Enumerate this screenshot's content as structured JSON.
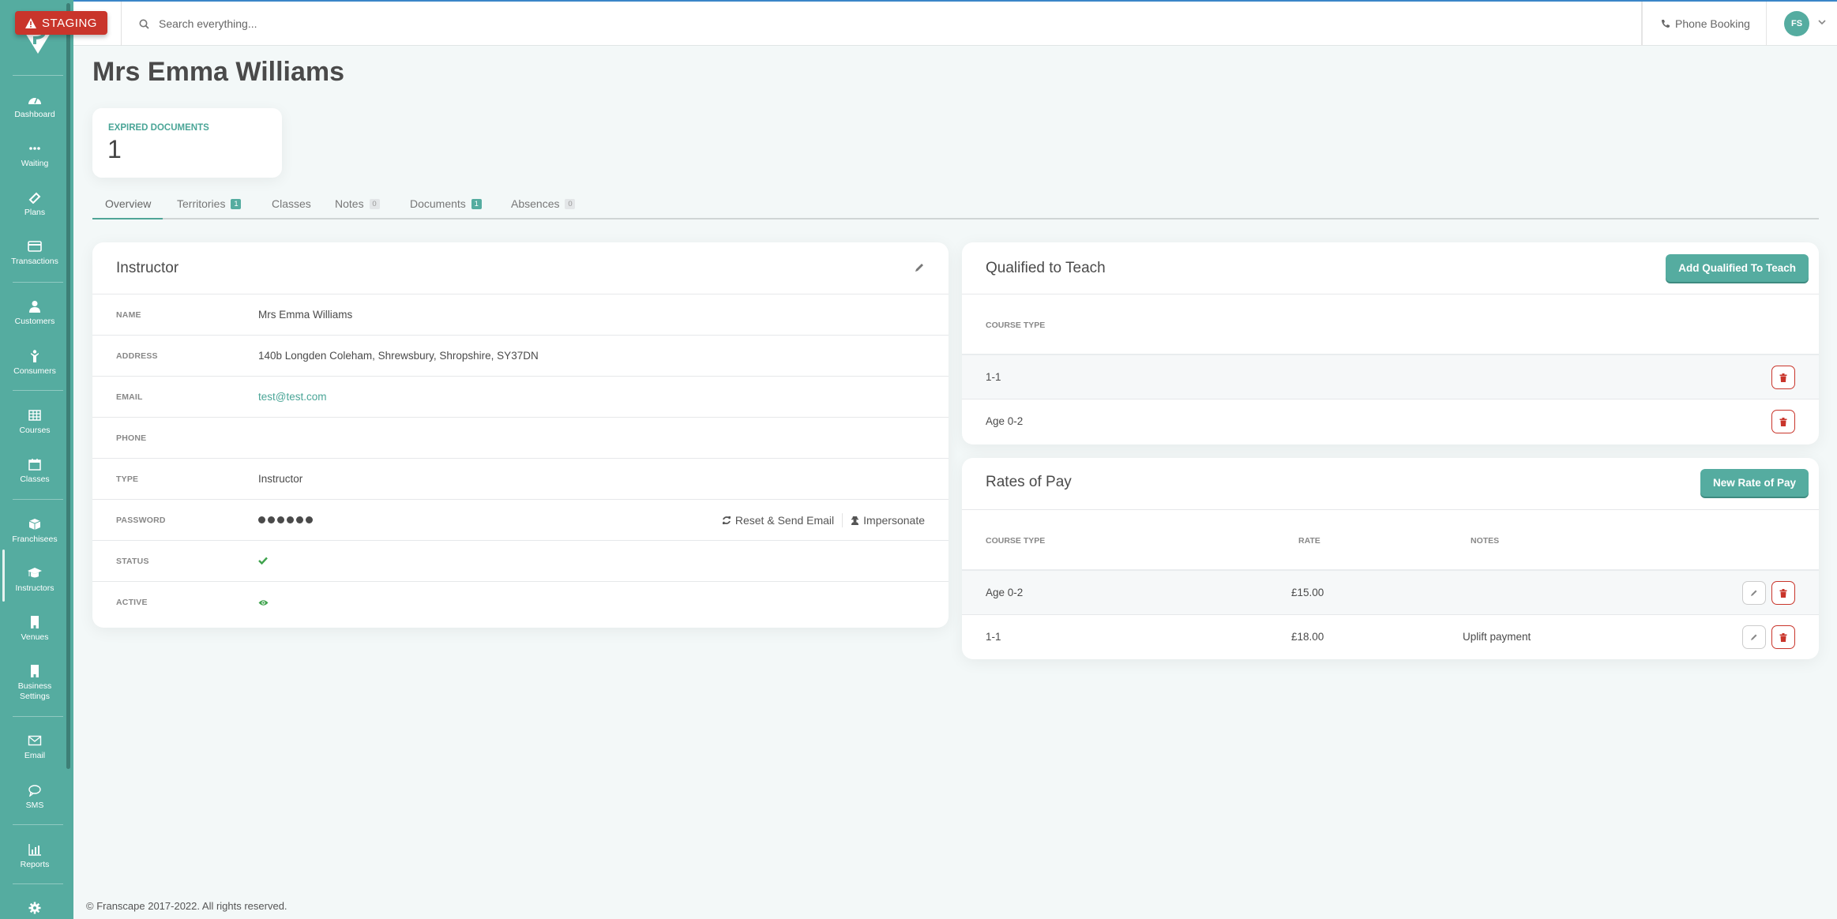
{
  "environment_badge": "STAGING",
  "sidebar": {
    "items": [
      {
        "label": "Dashboard",
        "icon": "tachometer-icon"
      },
      {
        "label": "Waiting",
        "icon": "ellipsis-icon"
      },
      {
        "label": "Plans",
        "icon": "ticket-icon"
      },
      {
        "label": "Transactions",
        "icon": "credit-card-icon"
      },
      {
        "label": "Customers",
        "icon": "user-icon"
      },
      {
        "label": "Consumers",
        "icon": "child-icon"
      },
      {
        "label": "Courses",
        "icon": "table-icon"
      },
      {
        "label": "Classes",
        "icon": "calendar-icon"
      },
      {
        "label": "Franchisees",
        "icon": "cube-icon"
      },
      {
        "label": "Instructors",
        "icon": "graduation-cap-icon"
      },
      {
        "label": "Venues",
        "icon": "building-icon"
      },
      {
        "label": "Business Settings",
        "icon": "building-icon"
      },
      {
        "label": "Email",
        "icon": "envelope-icon"
      },
      {
        "label": "SMS",
        "icon": "comment-icon"
      },
      {
        "label": "Reports",
        "icon": "bar-chart-icon"
      },
      {
        "label": "",
        "icon": "gear-icon"
      }
    ],
    "active": "Instructors"
  },
  "topbar": {
    "search_placeholder": "Search everything...",
    "phone_booking": "Phone Booking",
    "user_initials": "FS"
  },
  "page": {
    "title": "Mrs Emma Williams",
    "stat": {
      "label": "EXPIRED DOCUMENTS",
      "value": "1"
    }
  },
  "tabs": [
    {
      "label": "Overview",
      "badge": null,
      "active": true
    },
    {
      "label": "Territories",
      "badge": "1",
      "badge_style": "teal"
    },
    {
      "label": "Classes",
      "badge": null
    },
    {
      "label": "Notes",
      "badge": "0",
      "badge_style": "grey"
    },
    {
      "label": "Documents",
      "badge": "1",
      "badge_style": "teal"
    },
    {
      "label": "Absences",
      "badge": "0",
      "badge_style": "grey"
    }
  ],
  "instructor": {
    "title": "Instructor",
    "fields": {
      "name": {
        "label": "NAME",
        "value": "Mrs Emma Williams"
      },
      "address": {
        "label": "ADDRESS",
        "value": "140b Longden Coleham, Shrewsbury, Shropshire, SY37DN"
      },
      "email": {
        "label": "EMAIL",
        "value": "test@test.com"
      },
      "phone": {
        "label": "PHONE",
        "value": ""
      },
      "type": {
        "label": "TYPE",
        "value": "Instructor"
      },
      "password": {
        "label": "PASSWORD",
        "value": "••••••"
      },
      "status": {
        "label": "STATUS",
        "value": "check"
      },
      "active": {
        "label": "ACTIVE",
        "value": "eye"
      }
    },
    "reset_label": "Reset & Send Email",
    "impersonate_label": "Impersonate"
  },
  "qualified": {
    "title": "Qualified to Teach",
    "add_button": "Add Qualified To Teach",
    "column": "COURSE TYPE",
    "rows": [
      "1-1",
      "Age 0-2"
    ]
  },
  "rates": {
    "title": "Rates of Pay",
    "add_button": "New Rate of Pay",
    "columns": {
      "course_type": "COURSE TYPE",
      "rate": "RATE",
      "notes": "NOTES"
    },
    "rows": [
      {
        "course_type": "Age 0-2",
        "rate": "£15.00",
        "notes": ""
      },
      {
        "course_type": "1-1",
        "rate": "£18.00",
        "notes": "Uplift payment"
      }
    ]
  },
  "footer": "© Franscape 2017-2022. All rights reserved.",
  "colors": {
    "accent": "#55aca0",
    "danger": "#c9352b",
    "success": "#3fa34d"
  }
}
